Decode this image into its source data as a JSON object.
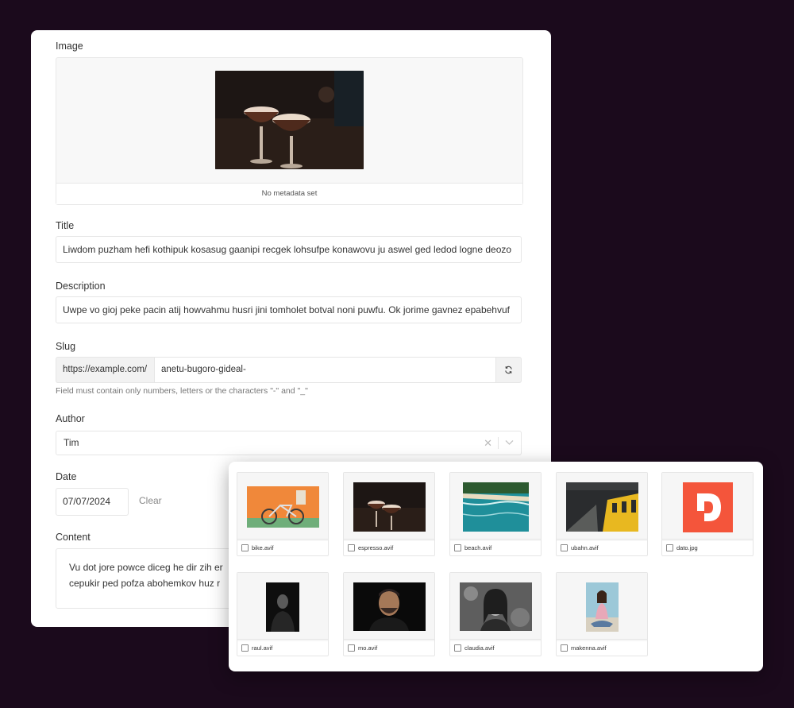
{
  "form": {
    "image": {
      "label": "Image",
      "metadata_text": "No metadata set"
    },
    "title": {
      "label": "Title",
      "value": "Liwdom puzham hefi kothipuk kosasug gaanipi recgek lohsufpe konawovu ju aswel ged ledod logne deozo"
    },
    "description": {
      "label": "Description",
      "value": "Uwpe vo gioj peke pacin atij howvahmu husri jini tomholet botval noni puwfu. Ok jorime gavnez epabehvuf"
    },
    "slug": {
      "label": "Slug",
      "prefix": "https://example.com/",
      "value": "anetu-bugoro-gideal-",
      "hint": "Field must contain only numbers, letters or the characters \"-\" and \"_\""
    },
    "author": {
      "label": "Author",
      "value": "Tim"
    },
    "date": {
      "label": "Date",
      "value": "07/07/2024",
      "clear_label": "Clear"
    },
    "content": {
      "label": "Content",
      "line1": "Vu dot jore powce diceg he dir zih er",
      "line2": "cepukir ped pofza abohemkov huz r"
    }
  },
  "media_library": {
    "items": [
      {
        "filename": "bike.avif",
        "thumb": "bike"
      },
      {
        "filename": "espresso.avif",
        "thumb": "espresso"
      },
      {
        "filename": "beach.avif",
        "thumb": "beach"
      },
      {
        "filename": "ubahn.avif",
        "thumb": "ubahn"
      },
      {
        "filename": "dato.jpg",
        "thumb": "dato"
      },
      {
        "filename": "raul.avif",
        "thumb": "raul"
      },
      {
        "filename": "mo.avif",
        "thumb": "mo"
      },
      {
        "filename": "claudia.avif",
        "thumb": "claudia"
      },
      {
        "filename": "makenna.avif",
        "thumb": "makenna"
      }
    ]
  },
  "colors": {
    "background": "#1b0a1c",
    "card": "#ffffff",
    "dato_brand": "#f4553b"
  },
  "icons": {
    "refresh": "refresh-icon",
    "clear": "clear-icon",
    "chevron": "chevron-down-icon"
  }
}
